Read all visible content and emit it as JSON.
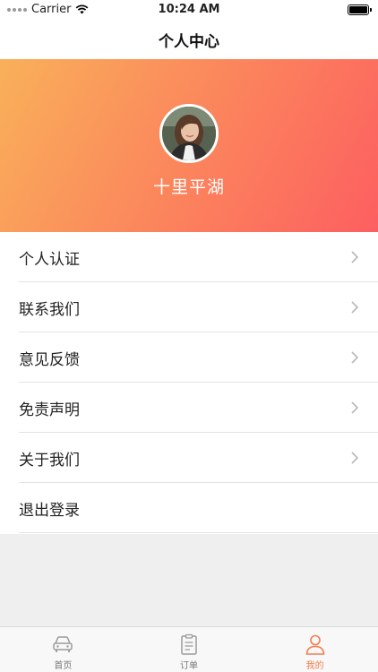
{
  "status_bar": {
    "carrier": "Carrier",
    "time": "10:24 AM"
  },
  "nav": {
    "title": "个人中心"
  },
  "profile": {
    "username": "十里平湖"
  },
  "menu": {
    "items": [
      {
        "label": "个人认证",
        "chevron": true
      },
      {
        "label": "联系我们",
        "chevron": true
      },
      {
        "label": "意见反馈",
        "chevron": true
      },
      {
        "label": "免责声明",
        "chevron": true
      },
      {
        "label": "关于我们",
        "chevron": true
      },
      {
        "label": "退出登录",
        "chevron": false
      }
    ]
  },
  "tabbar": {
    "tabs": [
      {
        "label": "首页",
        "icon": "car-icon",
        "active": false
      },
      {
        "label": "订单",
        "icon": "clipboard-icon",
        "active": false
      },
      {
        "label": "我的",
        "icon": "person-icon",
        "active": true
      }
    ]
  },
  "colors": {
    "accent": "#f57c4c",
    "gradient_start": "#f9b05a",
    "gradient_end": "#fd5f60"
  }
}
